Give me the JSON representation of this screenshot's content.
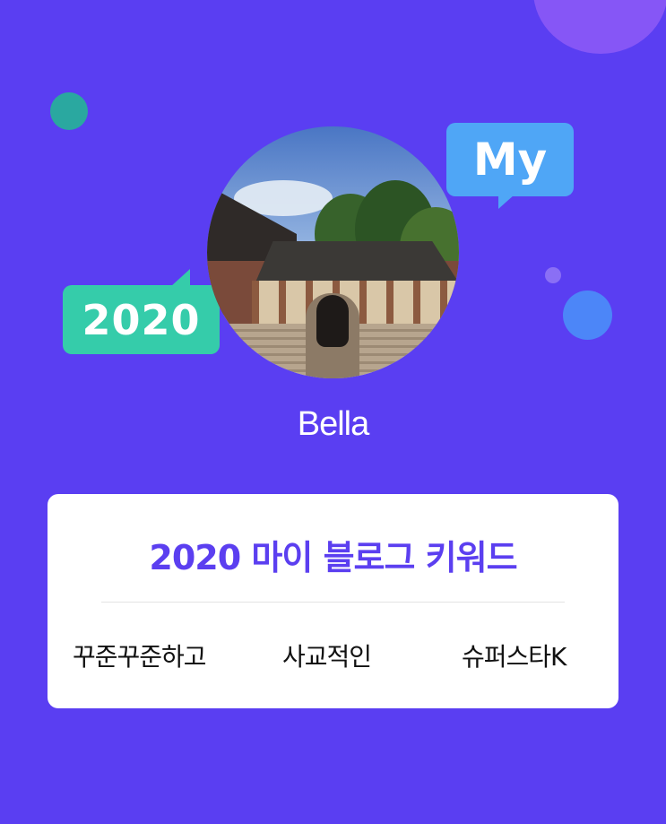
{
  "profile": {
    "name": "Bella",
    "avatar_icon": "profile-photo"
  },
  "stickers": {
    "my_label": "My",
    "year_label": "2020",
    "my_color": "#4fa6f6",
    "year_color": "#35ccaa"
  },
  "card": {
    "title": "2020 마이 블로그 키워드",
    "keywords": [
      "꾸준꾸준하고",
      "사교적인",
      "슈퍼스타K"
    ]
  },
  "colors": {
    "background": "#5a3ef2",
    "title_accent": "#5b3ff0",
    "card_bg": "#ffffff"
  }
}
